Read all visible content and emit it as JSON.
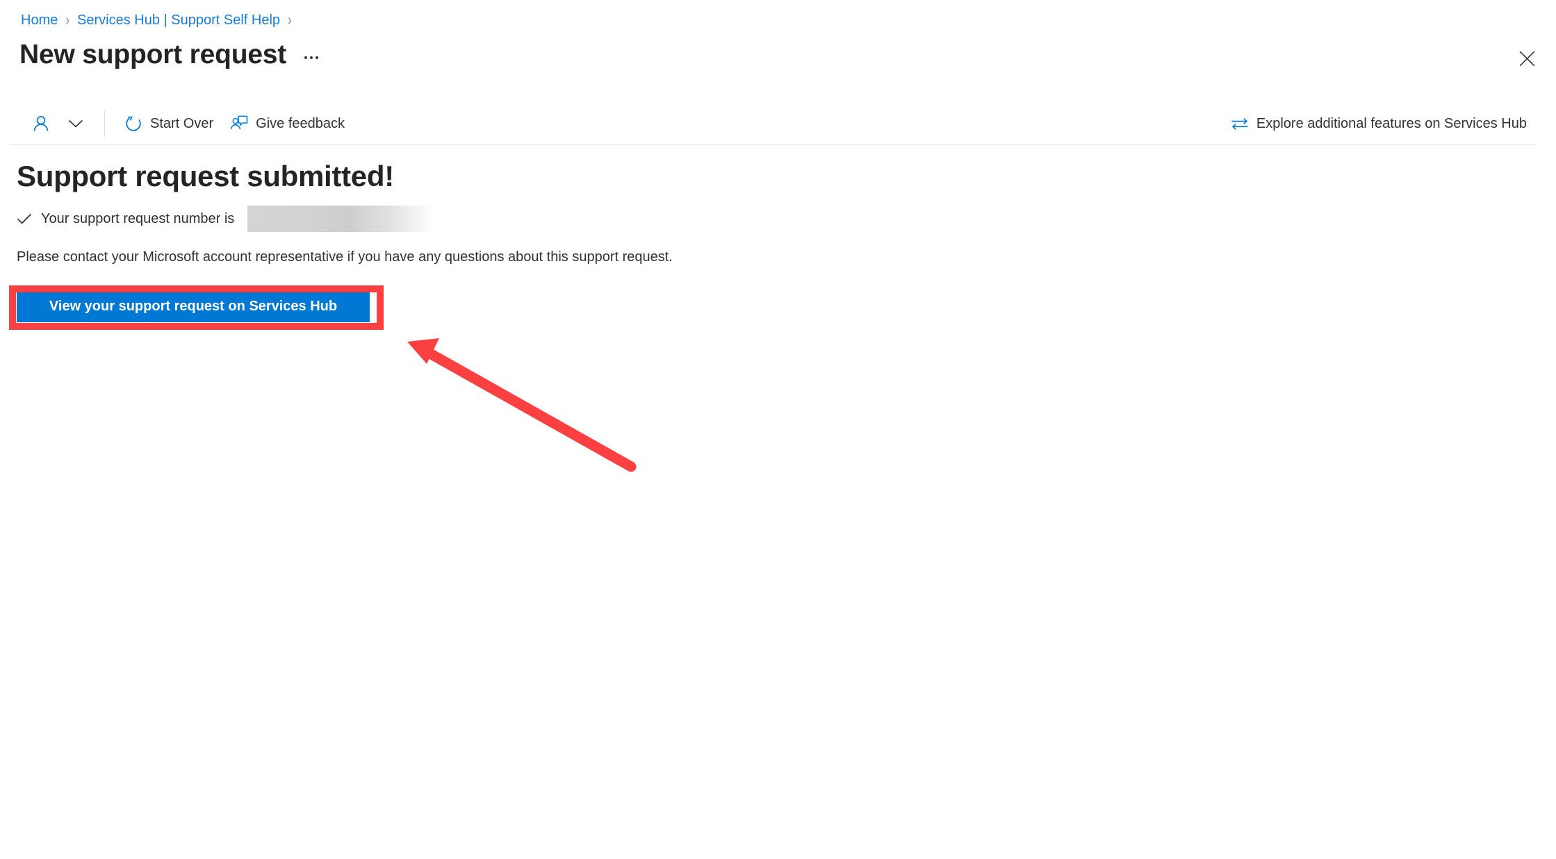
{
  "breadcrumb": {
    "items": [
      {
        "label": "Home",
        "type": "link"
      },
      {
        "label": "Services Hub | Support Self Help",
        "type": "link"
      }
    ],
    "separator": "›"
  },
  "header": {
    "title": "New support request",
    "more_actions_label": "More actions",
    "close_label": "Close"
  },
  "command_bar": {
    "avatar_icon": "person-icon",
    "chevron_icon": "chevron-down-icon",
    "items": [
      {
        "label": "Start Over",
        "icon": "reset-circular-arrow-icon"
      },
      {
        "label": "Give feedback",
        "icon": "person-feedback-icon"
      }
    ],
    "right_item": {
      "label": "Explore additional features on Services Hub",
      "icon": "exchange-arrows-icon"
    }
  },
  "main": {
    "heading": "Support request submitted!",
    "confirmation_prefix": "Your support request number is",
    "confirmation_value_redacted": "",
    "confirmation_icon": "checkmark-icon",
    "body_text": "Please contact your Microsoft account representative if you have any questions about this support request.",
    "primary_button_label": "View your support request on Services Hub"
  },
  "annotation": {
    "highlight_color": "#fa4040",
    "arrow_color": "#fa4040",
    "target": "view-support-request-button"
  },
  "colors": {
    "accent_blue": "#0078d4",
    "link_blue": "#1a7bd4",
    "text_primary": "#252423",
    "text_body": "#323130",
    "divider": "#e5e5e5",
    "annotation_red": "#fa4040"
  }
}
